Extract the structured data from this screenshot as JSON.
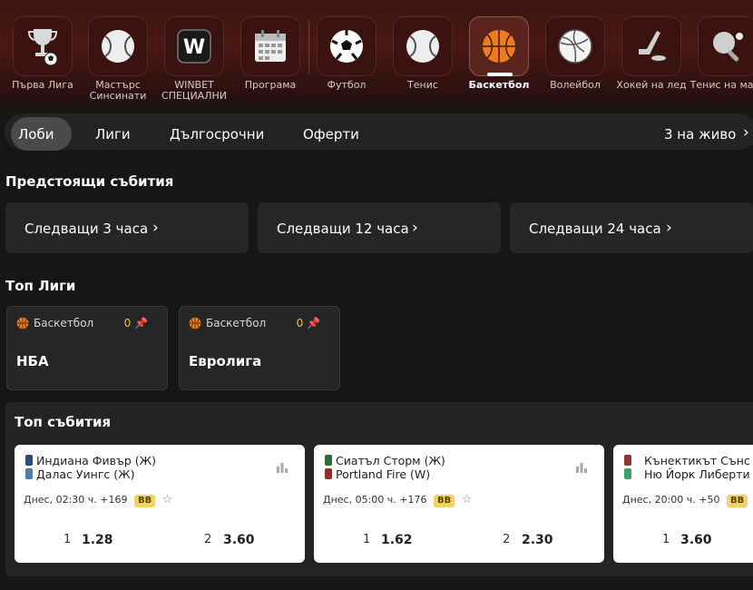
{
  "sports": [
    {
      "label": "Първа Лига",
      "icon": "trophy-icon",
      "active": false
    },
    {
      "label": "Мастърс Синсинати",
      "icon": "tennis-ball-icon",
      "active": false
    },
    {
      "label": "WINBET СПЕЦИАЛНИ",
      "icon": "winbet-w-icon",
      "active": false
    },
    {
      "label": "Програма",
      "icon": "calendar-icon",
      "active": false
    },
    {
      "label": "Футбол",
      "icon": "soccer-ball-icon",
      "active": false
    },
    {
      "label": "Тенис",
      "icon": "tennis-ball-icon",
      "active": false
    },
    {
      "label": "Баскетбол",
      "icon": "basketball-icon",
      "active": true
    },
    {
      "label": "Волейбол",
      "icon": "volleyball-icon",
      "active": false
    },
    {
      "label": "Хокей на лед",
      "icon": "hockey-icon",
      "active": false
    },
    {
      "label": "Тенис на маса",
      "icon": "table-tennis-icon",
      "active": false
    }
  ],
  "tabs": {
    "lobby": "Лоби",
    "leagues": "Лиги",
    "longterm": "Дългосрочни",
    "offers": "Оферти",
    "live": "3 на живо"
  },
  "upcoming": {
    "title": "Предстоящи събития",
    "items": [
      "Следващи 3 часа",
      "Следващи 12 часа",
      "Следващи 24 часа"
    ]
  },
  "top_leagues": {
    "title": "Топ Лиги",
    "items": [
      {
        "sport": "Баскетбол",
        "count": "0",
        "name": "НБА"
      },
      {
        "sport": "Баскетбол",
        "count": "0",
        "name": "Евролига"
      }
    ]
  },
  "top_events": {
    "title": "Топ събития",
    "items": [
      {
        "team1": "Индиана Фивър (Ж)",
        "team2": "Далас Уингс (Ж)",
        "time": "Днес, 02:30 ч.",
        "markets": "+169",
        "badge": "BB",
        "sel1": "1",
        "odd1": "1.28",
        "sel2": "2",
        "odd2": "3.60",
        "colors": [
          "#2c4a7a",
          "#4a7fb0"
        ]
      },
      {
        "team1": "Сиатъл Сторм (Ж)",
        "team2": "Portland Fire (W)",
        "time": "Днес, 05:00 ч.",
        "markets": "+176",
        "badge": "BB",
        "sel1": "1",
        "odd1": "1.62",
        "sel2": "2",
        "odd2": "2.30",
        "colors": [
          "#2e6b3a",
          "#9a2a2a"
        ]
      },
      {
        "team1": "Кънектикът Сънс",
        "team2": "Ню Йорк Либерти",
        "time": "Днес, 20:00 ч.",
        "markets": "+50",
        "badge": "BB",
        "sel1": "1",
        "odd1": "3.60",
        "sel2": "",
        "odd2": "",
        "colors": [
          "#8a3b2a",
          "#3fa06a"
        ]
      }
    ]
  }
}
